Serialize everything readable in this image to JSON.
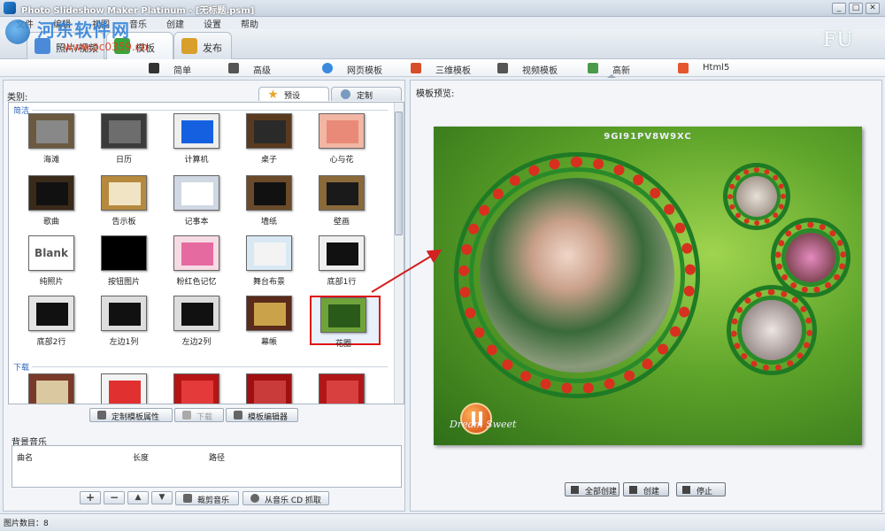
{
  "window": {
    "title": "Photo Slideshow Maker Platinum - [无标题.psm]",
    "controls": [
      "_",
      "□",
      "✕"
    ]
  },
  "menu": [
    "文件",
    "编辑",
    "视图",
    "音乐",
    "创建",
    "设置",
    "帮助"
  ],
  "watermark": {
    "text": "河东软件网",
    "url": "www.pc0359.cn"
  },
  "mode_tabs": [
    {
      "label": "照片/视频",
      "icon": "photo-icon",
      "color": "#4a8ad8",
      "active": false
    },
    {
      "label": "模板",
      "icon": "template-icon",
      "color": "#3aa33a",
      "active": true
    },
    {
      "label": "发布",
      "icon": "publish-icon",
      "color": "#d8a02a",
      "active": false
    }
  ],
  "brand_mark": "FU",
  "toolbar": [
    {
      "label": "简单",
      "icon": "piano-icon",
      "color": "#333333"
    },
    {
      "label": "高级",
      "icon": "camera-icon",
      "color": "#555555"
    },
    {
      "label": "网页模板",
      "icon": "web-icon",
      "color": "#3a8adf"
    },
    {
      "label": "三维模板",
      "icon": "3d-icon",
      "color": "#d74f2a"
    },
    {
      "label": "视频模板",
      "icon": "film-icon",
      "color": "#555555"
    },
    {
      "label": "高新",
      "icon": "picture-icon",
      "color": "#4a9a4a"
    },
    {
      "label": "Html5",
      "icon": "html5-icon",
      "color": "#e4572e"
    }
  ],
  "left_panel": {
    "category_label": "类别:",
    "sub_tabs": [
      {
        "label": "预设",
        "icon": "star-icon",
        "active": true
      },
      {
        "label": "定制",
        "icon": "custom-icon",
        "active": false
      }
    ],
    "groups": [
      {
        "label": "简洁"
      },
      {
        "label": "下载"
      }
    ],
    "templates": [
      {
        "label": "海滩",
        "bg": "#6b5a3f",
        "inner": "#888888"
      },
      {
        "label": "日历",
        "bg": "#3b3b3b",
        "inner": "#6d6d6d"
      },
      {
        "label": "计算机",
        "bg": "#eeeeee",
        "inner": "#1560e0"
      },
      {
        "label": "桌子",
        "bg": "#5a3a1e",
        "inner": "#2a2a2a"
      },
      {
        "label": "心与花",
        "bg": "#f2b6a4",
        "inner": "#e88a77"
      },
      {
        "label": "歌曲",
        "bg": "#3a2a1a",
        "inner": "#111111"
      },
      {
        "label": "告示板",
        "bg": "#b5893e",
        "inner": "#f1e4c4"
      },
      {
        "label": "记事本",
        "bg": "#cfd8e3",
        "inner": "#ffffff"
      },
      {
        "label": "墙纸",
        "bg": "#6a4a2a",
        "inner": "#111111"
      },
      {
        "label": "壁画",
        "bg": "#8a6a3a",
        "inner": "#1a1a1a"
      },
      {
        "label": "纯照片",
        "bg": "#ffffff",
        "inner": "#ffffff",
        "text": "Blank"
      },
      {
        "label": "按钮图片",
        "bg": "#000000",
        "inner": "#000000"
      },
      {
        "label": "粉红色记忆",
        "bg": "#f7dbe4",
        "inner": "#e56aa0"
      },
      {
        "label": "舞台布景",
        "bg": "#d8e9f4",
        "inner": "#f3f3f3"
      },
      {
        "label": "底部1行",
        "bg": "#efefef",
        "inner": "#111111"
      },
      {
        "label": "底部2行",
        "bg": "#e4e4e4",
        "inner": "#111111"
      },
      {
        "label": "左边1列",
        "bg": "#dddddd",
        "inner": "#111111"
      },
      {
        "label": "左边2列",
        "bg": "#dddddd",
        "inner": "#111111"
      },
      {
        "label": "幕帳",
        "bg": "#5a2a1a",
        "inner": "#c9a24a"
      },
      {
        "label": "花圈",
        "bg": "#6fa33a",
        "inner": "#2a5a1a",
        "selected": true
      },
      {
        "label": "",
        "bg": "#7a3a2a",
        "inner": "#d9c8a0"
      },
      {
        "label": "",
        "bg": "#f3f3f3",
        "inner": "#e03030"
      },
      {
        "label": "",
        "bg": "#b51515",
        "inner": "#e53a3a"
      },
      {
        "label": "",
        "bg": "#a01010",
        "inner": "#c93a3a"
      },
      {
        "label": "",
        "bg": "#b01818",
        "inner": "#d84040"
      }
    ],
    "actions": [
      {
        "label": "定制模板属性",
        "icon": "gear-icon",
        "disabled": false
      },
      {
        "label": "下载",
        "icon": "download-icon",
        "disabled": true
      },
      {
        "label": "模板编辑器",
        "icon": "edit-icon",
        "disabled": false
      }
    ],
    "bg_music": {
      "label": "背景音乐",
      "columns": [
        "曲名",
        "长度",
        "路径"
      ]
    },
    "music_buttons": [
      {
        "symbol": "+",
        "name": "add-button"
      },
      {
        "symbol": "−",
        "name": "remove-button"
      },
      {
        "symbol": "▲",
        "name": "move-up-button"
      },
      {
        "symbol": "▼",
        "name": "move-down-button"
      }
    ],
    "music_actions": [
      {
        "label": "裁剪音乐",
        "icon": "scissors-icon"
      },
      {
        "label": "从音乐 CD 抓取",
        "icon": "cd-icon"
      }
    ]
  },
  "right_panel": {
    "preview_label": "模板预览:",
    "preview_code": "9GI91PV8W9XC",
    "preview_signature": "Dream Sweet",
    "actions": [
      {
        "label": "全部创建",
        "icon": "create-all-icon"
      },
      {
        "label": "创建",
        "icon": "create-icon"
      },
      {
        "label": "停止",
        "icon": "stop-icon"
      }
    ]
  },
  "status": {
    "label": "图片数目：8"
  },
  "colors": {
    "accent": "#2c7fd8",
    "selection": "#e01414",
    "preview_green": "#5ea42a"
  }
}
